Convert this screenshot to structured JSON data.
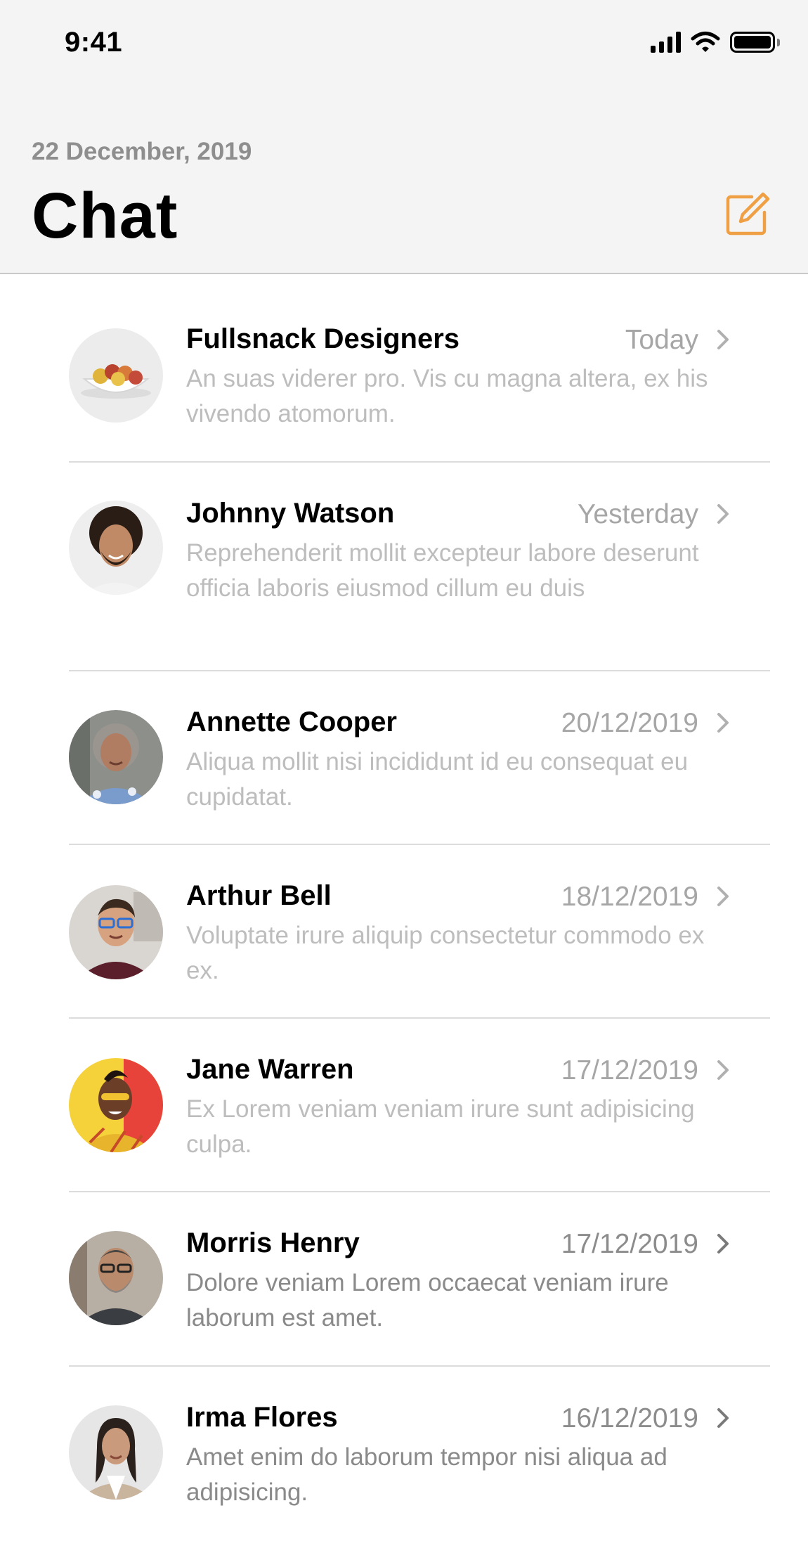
{
  "status_bar": {
    "time": "9:41"
  },
  "header": {
    "date": "22 December, 2019",
    "title": "Chat",
    "accent_color": "#F0A044"
  },
  "chats": [
    {
      "name": "Fullsnack Designers",
      "date": "Today",
      "preview": "An suas viderer pro. Vis cu magna altera, ex his vivendo atomorum."
    },
    {
      "name": "Johnny Watson",
      "date": "Yesterday",
      "preview": "Reprehenderit mollit excepteur labore deserunt officia laboris eiusmod cillum eu duis"
    },
    {
      "name": "Annette Cooper",
      "date": "20/12/2019",
      "preview": "Aliqua mollit nisi incididunt id eu consequat eu cupidatat."
    },
    {
      "name": "Arthur Bell",
      "date": "18/12/2019",
      "preview": "Voluptate irure aliquip consectetur commodo ex ex."
    },
    {
      "name": "Jane Warren",
      "date": "17/12/2019",
      "preview": "Ex Lorem veniam veniam irure sunt adipisicing culpa."
    },
    {
      "name": "Morris Henry",
      "date": "17/12/2019",
      "preview": "Dolore veniam Lorem occaecat veniam irure laborum est amet."
    },
    {
      "name": "Irma Flores",
      "date": "16/12/2019",
      "preview": "Amet enim do laborum tempor nisi aliqua ad adipisicing."
    }
  ]
}
